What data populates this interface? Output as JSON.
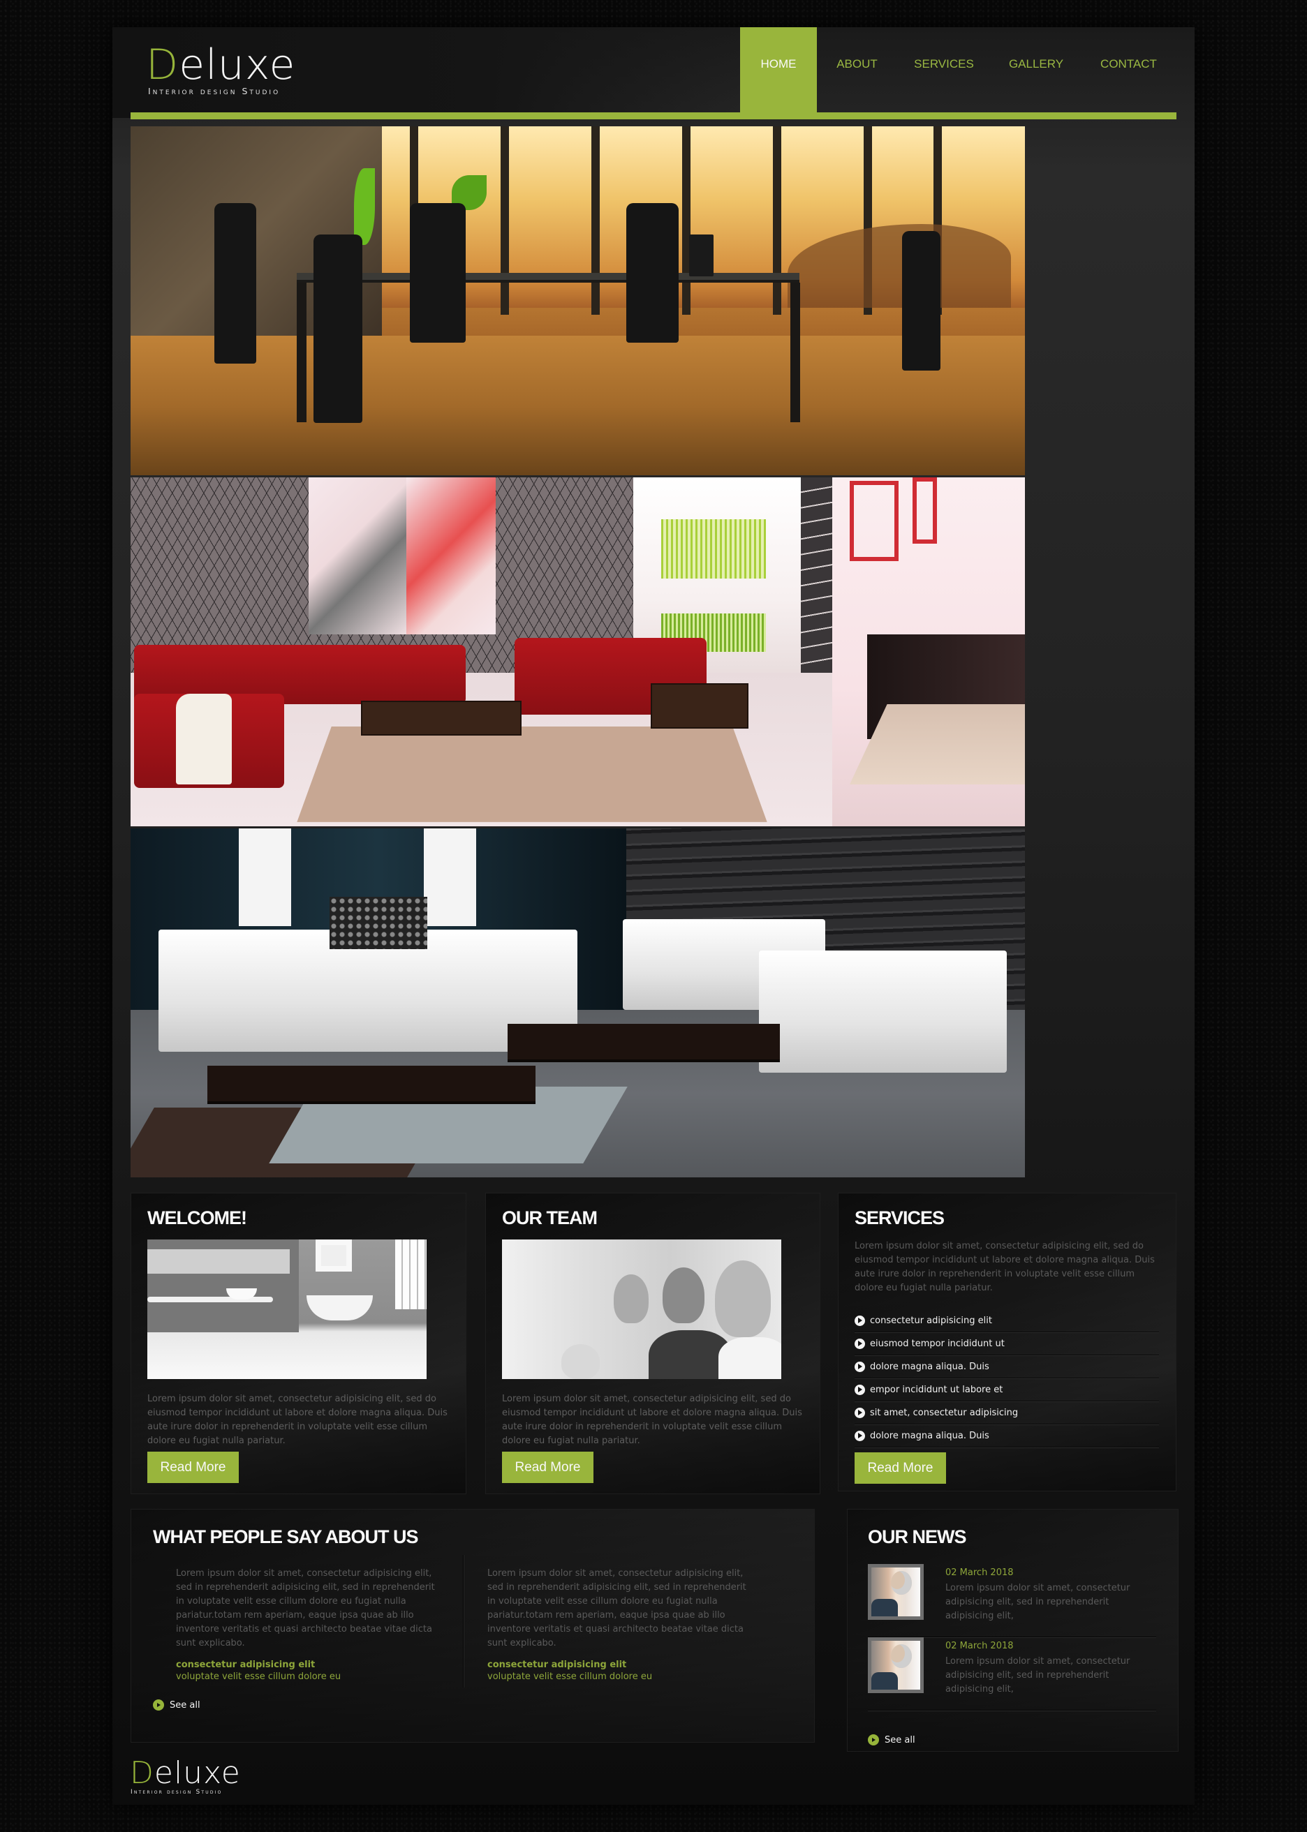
{
  "brand": {
    "first_letter": "D",
    "rest": "eluxe",
    "tagline": "Interior design Studio",
    "accent_color": "#99b53c"
  },
  "nav": {
    "items": [
      {
        "label": "HOME",
        "active": true
      },
      {
        "label": "ABOUT",
        "active": false
      },
      {
        "label": "SERVICES",
        "active": false
      },
      {
        "label": "GALLERY",
        "active": false
      },
      {
        "label": "CONTACT",
        "active": false
      }
    ]
  },
  "gallery": {
    "slides": [
      {
        "alt": "Office meeting room with black chairs and glass table"
      },
      {
        "alt": "Living room with red sofas and fireplace"
      },
      {
        "alt": "Living room with white sofa and armchairs"
      }
    ]
  },
  "boxes": {
    "welcome": {
      "title": "WELCOME!",
      "image_alt": "Modern bathroom",
      "text": "Lorem ipsum dolor sit amet, consectetur adipisicing elit, sed do eiusmod tempor incididunt ut labore et dolore magna aliqua. Duis aute irure dolor in reprehenderit in voluptate velit esse cillum dolore eu fugiat nulla pariatur.",
      "button": "Read More"
    },
    "team": {
      "title": "OUR TEAM",
      "image_alt": "Team applauding",
      "text": "Lorem ipsum dolor sit amet, consectetur adipisicing elit, sed do eiusmod tempor incididunt ut labore et dolore magna aliqua. Duis aute irure dolor in reprehenderit in voluptate velit esse cillum dolore eu fugiat nulla pariatur.",
      "button": "Read More"
    },
    "services": {
      "title": "SERVICES",
      "text": "Lorem ipsum dolor sit amet, consectetur adipisicing elit, sed do eiusmod tempor incididunt ut labore et dolore magna aliqua. Duis aute irure dolor in reprehenderit in voluptate velit esse cillum dolore eu fugiat nulla pariatur.",
      "list": [
        "consectetur adipisicing elit",
        "eiusmod tempor incididunt ut",
        "dolore magna aliqua. Duis",
        "empor incididunt ut labore et",
        "sit amet, consectetur adipisicing",
        "dolore magna aliqua. Duis"
      ],
      "button": "Read More"
    }
  },
  "testimonials": {
    "title": "WHAT PEOPLE SAY ABOUT US",
    "quotes": [
      {
        "text": "Lorem ipsum dolor sit amet, consectetur adipisicing elit, sed in reprehenderit adipisicing elit, sed in reprehenderit in voluptate velit esse cillum dolore eu fugiat nulla pariatur.totam rem aperiam, eaque ipsa quae ab illo inventore veritatis et quasi architecto beatae vitae dicta sunt explicabo.",
        "author": "consectetur adipisicing elit",
        "role": "voluptate velit esse cillum dolore eu"
      },
      {
        "text": "Lorem ipsum dolor sit amet, consectetur adipisicing elit, sed in reprehenderit adipisicing elit, sed in reprehenderit in voluptate velit esse cillum dolore eu fugiat nulla pariatur.totam rem aperiam, eaque ipsa quae ab illo inventore veritatis et quasi architecto beatae vitae dicta sunt explicabo.",
        "author": "consectetur adipisicing elit",
        "role": "voluptate velit esse cillum dolore eu"
      }
    ],
    "see_all": "See all"
  },
  "news": {
    "title": "OUR NEWS",
    "items": [
      {
        "date": "02 March 2018",
        "text": "Lorem ipsum dolor sit amet, consectetur adipisicing elit, sed in reprehenderit adipisicing elit,"
      },
      {
        "date": "02 March 2018",
        "text": "Lorem ipsum dolor sit amet, consectetur adipisicing elit, sed in reprehenderit adipisicing elit,"
      }
    ],
    "see_all": "See all"
  },
  "footer": {
    "first_letter": "D",
    "rest": "eluxe",
    "tagline": "Interior design Studio"
  }
}
